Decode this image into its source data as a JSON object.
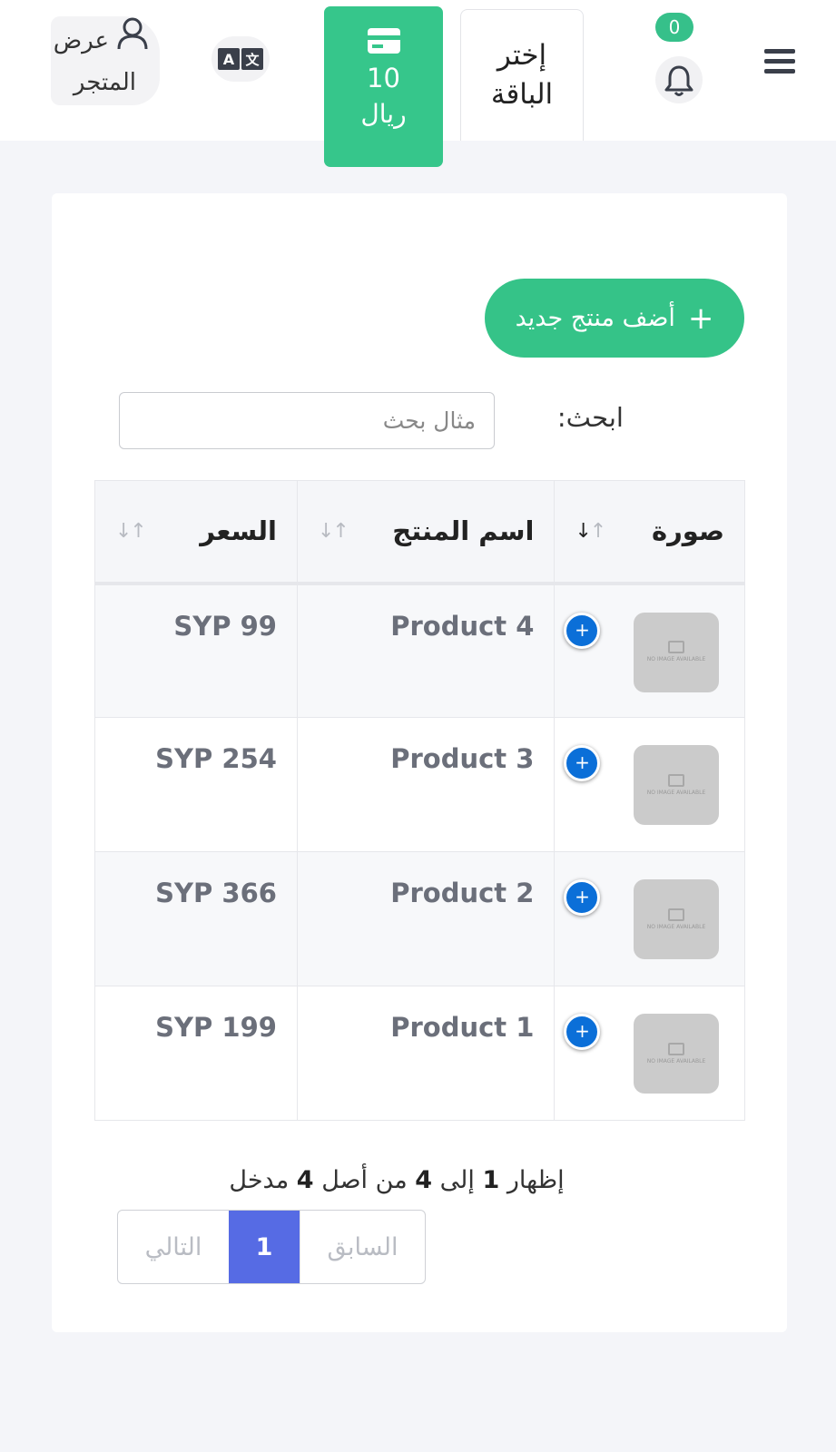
{
  "header": {
    "notifications": {
      "count": "0",
      "icon": "bell-icon"
    },
    "package_button": {
      "line1": "إختر",
      "line2": "الباقة"
    },
    "balance": {
      "amount": "10",
      "currency": "ريال",
      "icon": "credit-card-icon"
    },
    "language": {
      "icon": "translate-icon"
    },
    "store": {
      "line1": "عرض",
      "line2": "المتجر",
      "icon": "user-icon"
    },
    "menu_icon": "hamburger-menu-icon"
  },
  "main": {
    "add_button": {
      "label": "أضف منتج جديد",
      "icon": "+"
    },
    "search": {
      "label": "ابحث:",
      "placeholder": "مثال بحث",
      "value": ""
    },
    "table": {
      "columns": [
        "صورة",
        "اسم المنتج",
        "السعر"
      ],
      "rows": [
        {
          "name": "Product 4",
          "price": "SYP 99",
          "image": "NO IMAGE AVAILABLE"
        },
        {
          "name": "Product 3",
          "price": "SYP 254",
          "image": "NO IMAGE AVAILABLE"
        },
        {
          "name": "Product 2",
          "price": "SYP 366",
          "image": "NO IMAGE AVAILABLE"
        },
        {
          "name": "Product 1",
          "price": "SYP 199",
          "image": "NO IMAGE AVAILABLE"
        }
      ]
    },
    "info": {
      "prefix": "إظهار",
      "from": "1",
      "to_word": "إلى",
      "to": "4",
      "of_word": "من أصل",
      "total": "4",
      "suffix": "مدخل"
    },
    "pagination": {
      "previous": "السابق",
      "current": "1",
      "next": "التالي"
    }
  },
  "colors": {
    "accent_green": "#36c68b",
    "page_blue": "#566be4",
    "expand_blue": "#0b6fd8"
  }
}
